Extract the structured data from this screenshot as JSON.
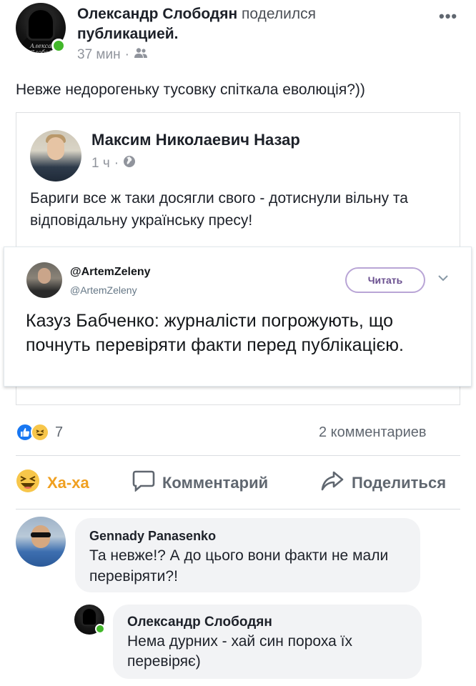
{
  "post": {
    "author": "Олександр Слободян",
    "action_text": "поделился",
    "object_text": "публикацией.",
    "time": "37 мин",
    "audience_icon": "friends-icon",
    "more_icon": "more-dots-icon",
    "text": "Невже недорогеньку тусовку спіткала еволюція?))"
  },
  "shared_post": {
    "author": "Максим Николаевич Назар",
    "time": "1 ч",
    "audience_icon": "globe-icon",
    "text": "Бариги все ж таки досягли свого - дотиснули вільну та відповідальну українську пресу!"
  },
  "tweet": {
    "name": "@ArtemZeleny",
    "handle": "@ArtemZeleny",
    "follow_label": "Читать",
    "text": "Казуз Бабченко: журналісти погрожують, що почнуть перевіряти факти перед публікацією."
  },
  "reactions": {
    "types": [
      "like",
      "haha"
    ],
    "count": "7",
    "comments_label": "2 комментариев"
  },
  "actions": {
    "haha_label": "Ха-ха",
    "comment_label": "Комментарий",
    "share_label": "Поделиться"
  },
  "comments": [
    {
      "author": "Gennady Panasenko",
      "text": "Та невже!? А до цього вони факти не мали перевіряти?!"
    },
    {
      "author": "Олександр Слободян",
      "text": "Нема дурних - хай син пороха їх перевіряє)"
    }
  ],
  "colors": {
    "accent_blue": "#1877f2",
    "haha_yellow": "#f7c64a",
    "haha_label": "#f0a020",
    "online_green": "#42b72a",
    "follow_border": "#b9a5d6"
  }
}
